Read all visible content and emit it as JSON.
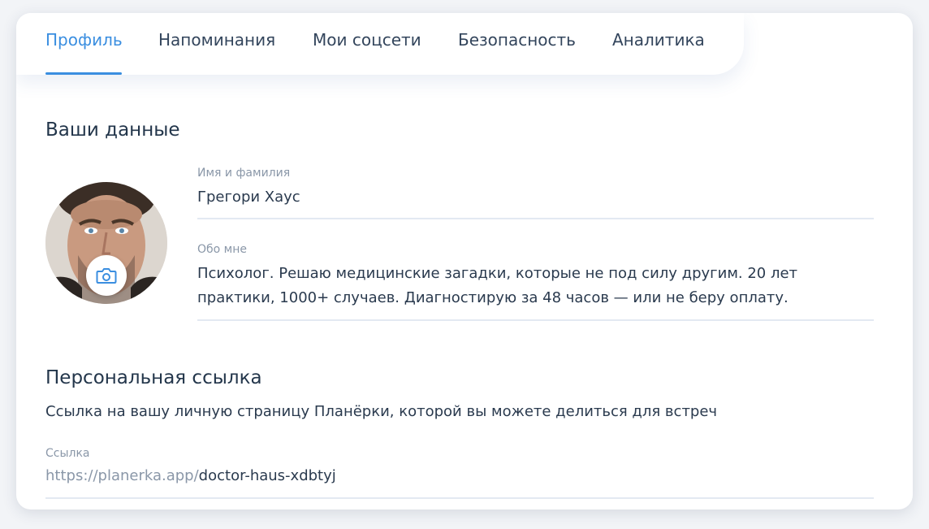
{
  "tabs": [
    {
      "label": "Профиль",
      "active": true
    },
    {
      "label": "Напоминания",
      "active": false
    },
    {
      "label": "Мои соцсети",
      "active": false
    },
    {
      "label": "Безопасность",
      "active": false
    },
    {
      "label": "Аналитика",
      "active": false
    }
  ],
  "profile": {
    "section_title": "Ваши данные",
    "name_label": "Имя и фамилия",
    "name_value": "Грегори Хаус",
    "about_label": "Обо мне",
    "about_value": "Психолог. Решаю медицинские загадки, которые не под силу другим. 20 лет практики, 1000+ случаев. Диагностирую за 48 часов — или не беру оплату.",
    "avatar_icon": "camera-icon"
  },
  "personal_link": {
    "section_title": "Персональная ссылка",
    "description": "Ссылка на вашу личную страницу Планёрки, которой вы можете делиться для встреч",
    "link_label": "Ссылка",
    "link_prefix": "https://planerka.app/",
    "link_slug": "doctor-haus-xdbtyj"
  },
  "colors": {
    "accent": "#3a8ee0",
    "text": "#2a3a4e",
    "muted": "#8a97a8",
    "divider": "#e3e9f2"
  }
}
